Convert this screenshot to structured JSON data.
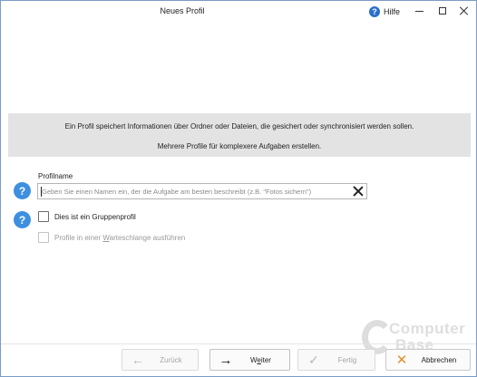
{
  "window": {
    "title": "Neues Profil",
    "help_label": "Hilfe",
    "help_icon": "?"
  },
  "info": {
    "line1": "Ein Profil speichert Informationen über Ordner oder Dateien, die gesichert oder synchronisiert werden sollen.",
    "line2": "Mehrere Profile für komplexere Aufgaben erstellen."
  },
  "form": {
    "help_icon": "?",
    "profile_name_label": "Profilname",
    "profile_name_value": "",
    "profile_name_placeholder": "Geben Sie einen Namen ein, der die Aufgabe am besten beschreibt (z.B. \"Fotos sichern\")",
    "group_profile_label": "Dies ist ein Gruppenprofil",
    "group_profile_checked": false,
    "queue_label_before": "Profile in einer ",
    "queue_label_underlined": "W",
    "queue_label_after": "arteschlange ausführen",
    "queue_checked": false,
    "queue_enabled": false
  },
  "footer": {
    "back_label": "Zurück",
    "back_icon": "←",
    "next_label_before": "W",
    "next_label_underlined": "e",
    "next_label_after": "iter",
    "next_icon": "→",
    "finish_label": "Fertig",
    "finish_icon": "✓",
    "cancel_label": "Abbrechen",
    "cancel_icon": "✕"
  },
  "watermark": {
    "line1": "Computer",
    "line2": "Base"
  }
}
